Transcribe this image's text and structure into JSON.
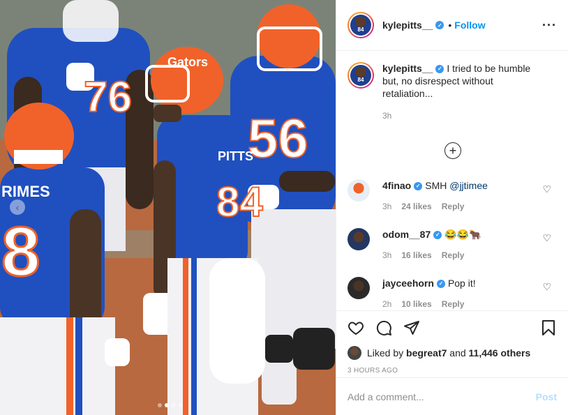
{
  "photo": {
    "slide_count": 4,
    "active_slide": 2,
    "nav_icon": "chevron-left-icon",
    "jerseys": {
      "left_nameplate": "RIMES",
      "left_number": "8",
      "center_nameplate": "PITTS",
      "center_number": "84",
      "right_number": "56",
      "back_number": "76",
      "helmet_text": "Gators"
    }
  },
  "header": {
    "username": "kylepitts__",
    "verified_icon": "verified-badge-icon",
    "bullet": "•",
    "follow_label": "Follow",
    "more_icon": "more-horizontal-icon",
    "avatar_number": "84"
  },
  "caption": {
    "username": "kylepitts__",
    "text": "I tried to be humble but, no disrespect without retaliation...",
    "time": "3h"
  },
  "load_more_icon": "plus-circle-icon",
  "comments": [
    {
      "username": "4finao",
      "text_plain": "SMH ",
      "mention": "@jjtimee",
      "time": "3h",
      "likes": "24 likes",
      "reply": "Reply",
      "avatar_color": "#e8eef5"
    },
    {
      "username": "odom__87",
      "text_plain": "😂😂",
      "mention": "",
      "emoji_tail": "🐂",
      "time": "3h",
      "likes": "16 likes",
      "reply": "Reply",
      "avatar_color": "#23375f"
    },
    {
      "username": "jayceehorn",
      "text_plain": "Pop it!",
      "mention": "",
      "time": "2h",
      "likes": "10 likes",
      "reply": "Reply",
      "avatar_color": "#2a2a2a"
    }
  ],
  "actions": {
    "like_icon": "heart-icon",
    "comment_icon": "comment-bubble-icon",
    "share_icon": "paper-plane-icon",
    "save_icon": "bookmark-icon",
    "liked_by_prefix": "Liked by ",
    "liked_by_user": "begreat7",
    "liked_by_and": " and ",
    "liked_by_others": "11,446 others",
    "timestamp": "3 hours ago"
  },
  "add_comment": {
    "placeholder": "Add a comment...",
    "post_label": "Post"
  },
  "colors": {
    "accent": "#0095f6",
    "verified": "#3897f0",
    "gators_blue": "#1b47b8",
    "gators_orange": "#f0622a",
    "post_disabled": "#b2dffc"
  }
}
